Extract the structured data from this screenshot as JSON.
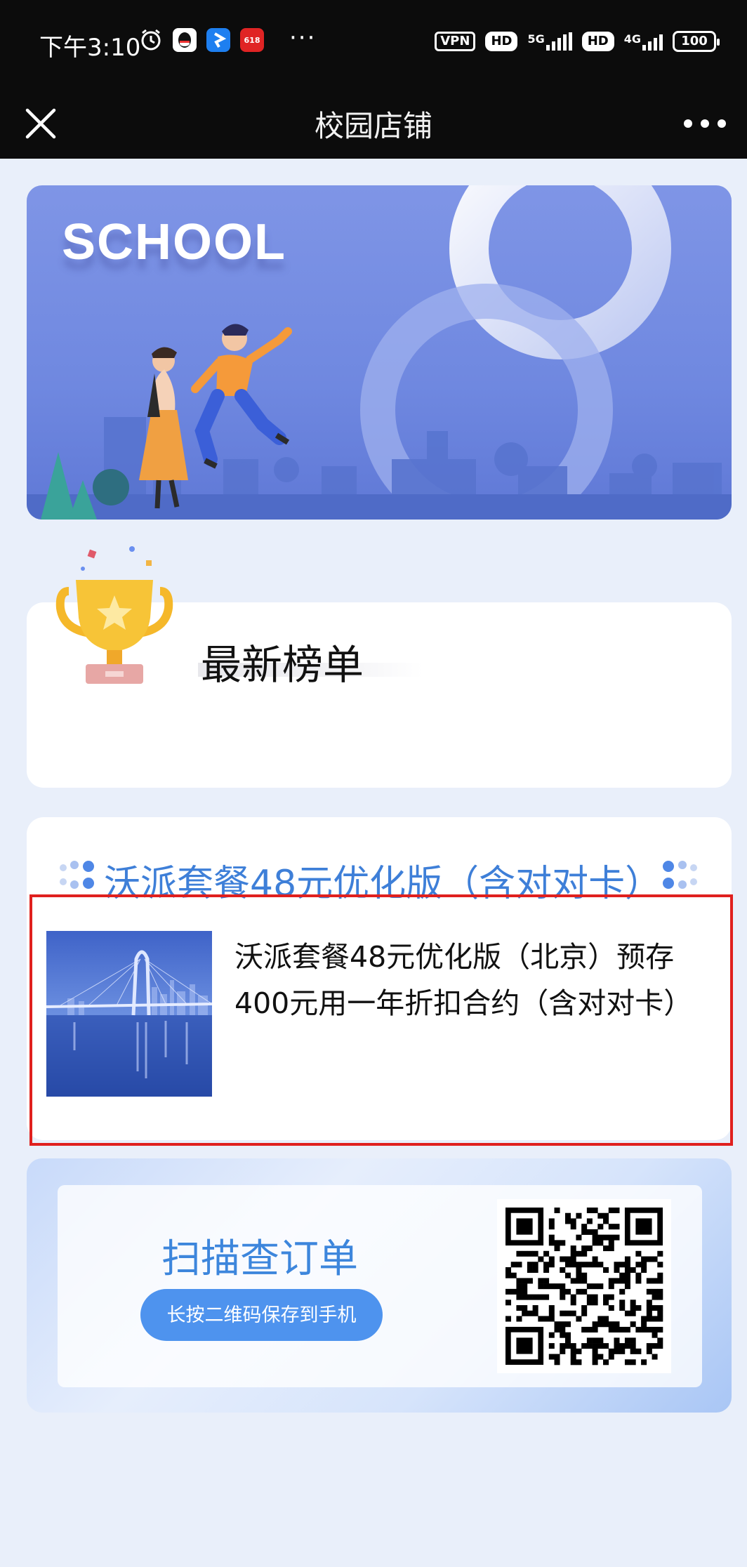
{
  "status_bar": {
    "time": "下午3:10",
    "more_dots": "···",
    "vpn": "VPN",
    "hd1": "HD",
    "net1": "5G",
    "hd2": "HD",
    "net2": "4G",
    "battery": "100"
  },
  "title_bar": {
    "title": "校园店铺"
  },
  "banner": {
    "headline": "SCHOOL"
  },
  "ranking": {
    "title": "最新榜单"
  },
  "product_section": {
    "header": "沃派套餐48元优化版（含对对卡）",
    "item": {
      "title": "沃派套餐48元优化版（北京）预存400元用一年折扣合约（含对对卡）"
    }
  },
  "qr_section": {
    "title": "扫描查订单",
    "button_label": "长按二维码保存到手机"
  },
  "colors": {
    "accent_blue": "#3e7fd8",
    "button_blue": "#4e93ee",
    "highlight_red": "#e0201e",
    "page_bg": "#e9effa"
  }
}
